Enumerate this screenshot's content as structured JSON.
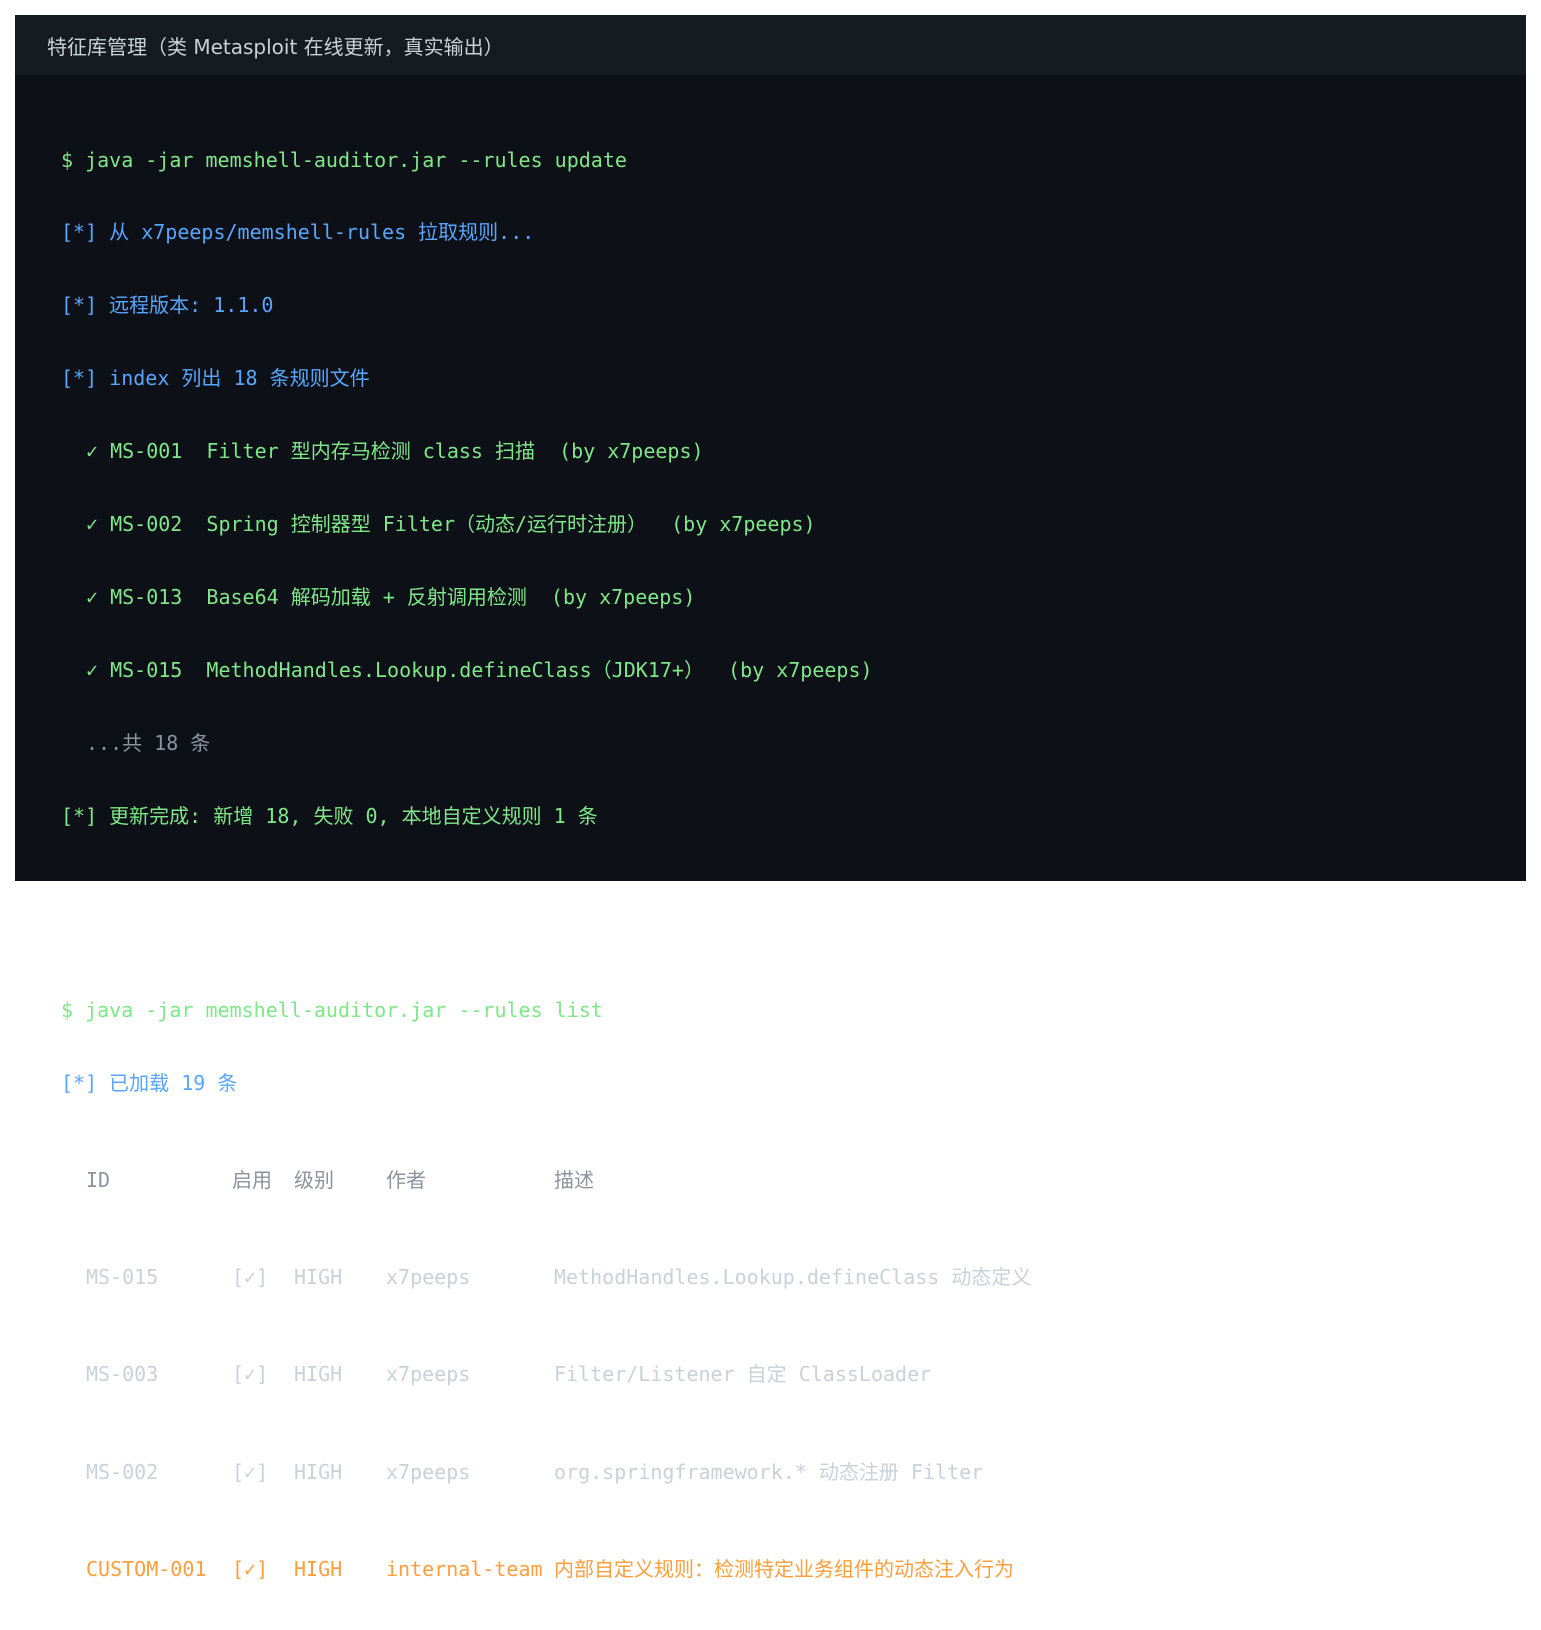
{
  "window": {
    "title": "特征库管理（类 Metasploit 在线更新，真实输出）"
  },
  "update": {
    "command": "$ java -jar memshell-auditor.jar --rules update",
    "lines_blue": [
      "[*] 从 x7peeps/memshell-rules 拉取规则...",
      "[*] 远程版本: 1.1.0",
      "[*] index 列出 18 条规则文件"
    ],
    "rules": [
      "✓ MS-001  Filter 型内存马检测 class 扫描  (by x7peeps)",
      "✓ MS-002  Spring 控制器型 Filter（动态/运行时注册）  (by x7peeps)",
      "✓ MS-013  Base64 解码加载 + 反射调用检测  (by x7peeps)",
      "✓ MS-015  MethodHandles.Lookup.defineClass（JDK17+）  (by x7peeps)"
    ],
    "more": "...共 18 条",
    "summary": "[*] 更新完成: 新增 18, 失败 0, 本地自定义规则 1 条"
  },
  "list": {
    "command": "$ java -jar memshell-auditor.jar --rules list",
    "count_line": "[*] 已加载 19 条",
    "headers": {
      "id": "ID",
      "enabled": "启用",
      "level": "级别",
      "author": "作者",
      "desc": "描述"
    },
    "rows": [
      {
        "id": "MS-015",
        "enabled": "[✓]",
        "level": "HIGH",
        "author": "x7peeps",
        "desc": "MethodHandles.Lookup.defineClass 动态定义",
        "custom": false
      },
      {
        "id": "MS-003",
        "enabled": "[✓]",
        "level": "HIGH",
        "author": "x7peeps",
        "desc": "Filter/Listener 自定 ClassLoader",
        "custom": false
      },
      {
        "id": "MS-002",
        "enabled": "[✓]",
        "level": "HIGH",
        "author": "x7peeps",
        "desc": "org.springframework.* 动态注册 Filter",
        "custom": false
      },
      {
        "id": "CUSTOM-001",
        "enabled": "[✓]",
        "level": "HIGH",
        "author": "internal-team",
        "desc": "内部自定义规则：检测特定业务组件的动态注入行为",
        "custom": true
      }
    ]
  },
  "colors": {
    "background": "#0d1117",
    "titlebar": "#161b22",
    "green": "#7ee787",
    "blue": "#58a6ff",
    "dim": "#8b949e",
    "orange": "#ff9e3d"
  }
}
